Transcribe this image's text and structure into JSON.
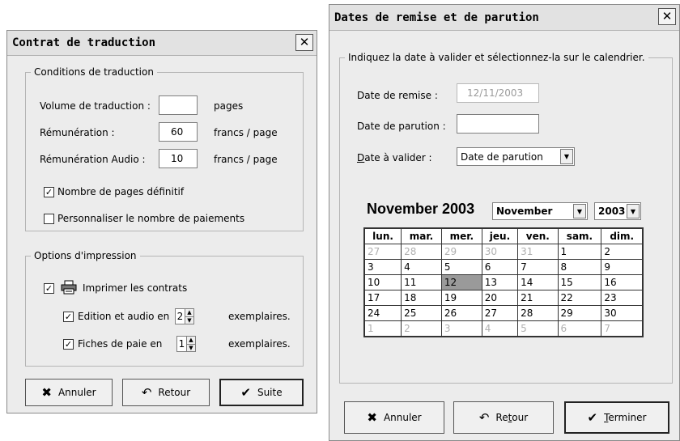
{
  "contrat": {
    "title": "Contrat de traduction",
    "close": "✕",
    "conditions": {
      "legend": "Conditions de traduction",
      "volume_label": "Volume de traduction :",
      "volume_value": "",
      "volume_unit": "pages",
      "remun_label": "Rémunération :",
      "remun_value": "60",
      "remun_unit": "francs / page",
      "audio_label": "Rémunération Audio :",
      "audio_value": "10",
      "audio_unit": "francs / page",
      "chk_definitif": "Nombre de pages définitif",
      "chk_definitif_checked": true,
      "chk_paiements": "Personnaliser le nombre de paiements",
      "chk_paiements_checked": false
    },
    "options": {
      "legend": "Options d'impression",
      "imprimer_label": "Imprimer les contrats",
      "imprimer_checked": true,
      "edition_label": "Edition et audio en",
      "edition_checked": true,
      "edition_value": "2",
      "edition_unit": "exemplaires.",
      "fiches_label": "Fiches de paie en",
      "fiches_checked": true,
      "fiches_value": "1",
      "fiches_unit": "exemplaires."
    },
    "buttons": {
      "cancel": "Annuler",
      "back": "Retour",
      "next": "Suite"
    }
  },
  "dates": {
    "title": "Dates de remise et de parution",
    "close": "✕",
    "legend": "Indiquez la date à valider et sélectionnez-la sur le calendrier.",
    "remise_label": "Date de remise :",
    "remise_value": "12/11/2003",
    "parution_label": "Date de parution :",
    "parution_value": "",
    "valider_first": "D",
    "valider_rest": "ate à valider :",
    "valider_value": "Date de parution",
    "calendar": {
      "title": "November 2003",
      "month_select": "November",
      "year_select": "2003",
      "weekdays": [
        "lun.",
        "mar.",
        "mer.",
        "jeu.",
        "ven.",
        "sam.",
        "dim."
      ],
      "weeks": [
        [
          "27",
          "28",
          "29",
          "30",
          "31",
          "1",
          "2"
        ],
        [
          "3",
          "4",
          "5",
          "6",
          "7",
          "8",
          "9"
        ],
        [
          "10",
          "11",
          "12",
          "13",
          "14",
          "15",
          "16"
        ],
        [
          "17",
          "18",
          "19",
          "20",
          "21",
          "22",
          "23"
        ],
        [
          "24",
          "25",
          "26",
          "27",
          "28",
          "29",
          "30"
        ],
        [
          "1",
          "2",
          "3",
          "4",
          "5",
          "6",
          "7"
        ]
      ],
      "selected_day": "12"
    },
    "buttons": {
      "cancel": "Annuler",
      "back_a": "Re",
      "back_u": "t",
      "back_b": "our",
      "finish_u": "T",
      "finish_b": "erminer"
    }
  }
}
